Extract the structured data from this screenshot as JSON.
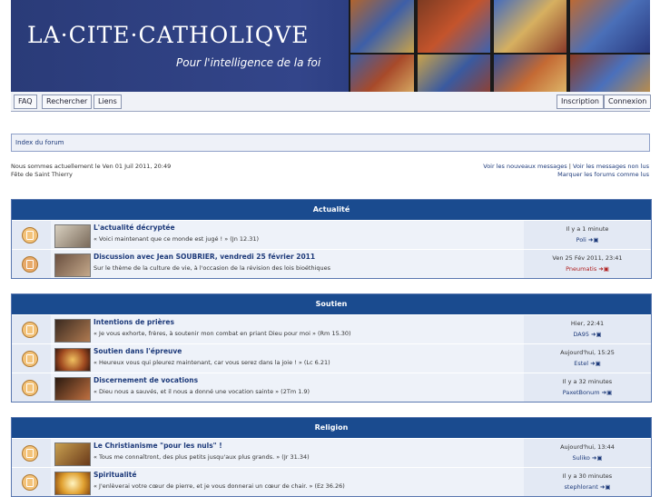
{
  "banner": {
    "title": "LA·CITE·CATHOLIQVE",
    "subtitle": "Pour l'intelligence de la foi"
  },
  "nav": {
    "faq": "FAQ",
    "search": "Rechercher",
    "links": "Liens",
    "register": "Inscription",
    "login": "Connexion"
  },
  "breadcrumb": "Index du forum",
  "info": {
    "now": "Nous sommes actuellement le Ven 01 Juil 2011, 20:49",
    "feast": "Fête de Saint Thierry",
    "new_msgs": "Voir les nouveaux messages",
    "sep": "|",
    "no_reply": "Voir les messages non lus",
    "mark_read": "Marquer les forums comme lus"
  },
  "sections": [
    {
      "title": "Actualité",
      "forums": [
        {
          "name": "L'actualité décryptée",
          "desc": "« Voici maintenant que ce monde est jugé ! » (Jn 12.31)",
          "last_date": "Il y a 1 minute",
          "last_user": "Poli",
          "locked": false,
          "user_red": false
        },
        {
          "name": "Discussion avec Jean SOUBRIER, vendredi 25 février 2011",
          "desc": "Sur le thème de la culture de vie, à l'occasion de la révision des lois bioéthiques",
          "last_date": "Ven 25 Fév 2011, 23:41",
          "last_user": "Pneumatis",
          "locked": true,
          "user_red": true
        }
      ]
    },
    {
      "title": "Soutien",
      "forums": [
        {
          "name": "Intentions de prières",
          "desc": "« Je vous exhorte, frères, à soutenir mon combat en priant Dieu pour moi » (Rm 15.30)",
          "last_date": "Hier, 22:41",
          "last_user": "DA95",
          "locked": false,
          "user_red": false
        },
        {
          "name": "Soutien dans l'épreuve",
          "desc": "« Heureux vous qui pleurez maintenant, car vous serez dans la joie ! » (Lc 6.21)",
          "last_date": "Aujourd'hui, 15:25",
          "last_user": "Estel",
          "locked": false,
          "user_red": false
        },
        {
          "name": "Discernement de vocations",
          "desc": "« Dieu nous a sauvés, et il nous a donné une vocation sainte » (2Tm 1.9)",
          "last_date": "Il y a 32 minutes",
          "last_user": "PaxetBonum",
          "locked": false,
          "user_red": false
        }
      ]
    },
    {
      "title": "Religion",
      "forums": [
        {
          "name": "Le Christianisme \"pour les nuls\" !",
          "desc": "« Tous me connaîtront, des plus petits jusqu'aux plus grands. » (Jr 31.34)",
          "last_date": "Aujourd'hui, 13:44",
          "last_user": "Suliko",
          "locked": false,
          "user_red": false
        },
        {
          "name": "Spiritualité",
          "desc": "« J'enlèverai votre cœur de pierre, et je vous donnerai un cœur de chair. » (Ez 36.26)",
          "last_date": "Il y a 30 minutes",
          "last_user": "stephlorant",
          "locked": false,
          "user_red": false
        }
      ]
    }
  ],
  "colors": {
    "header_bg": "#1a4b8f",
    "banner_bg": "#2a3b78",
    "link": "#1d3a7a",
    "row_bg": "#eef2f9"
  }
}
